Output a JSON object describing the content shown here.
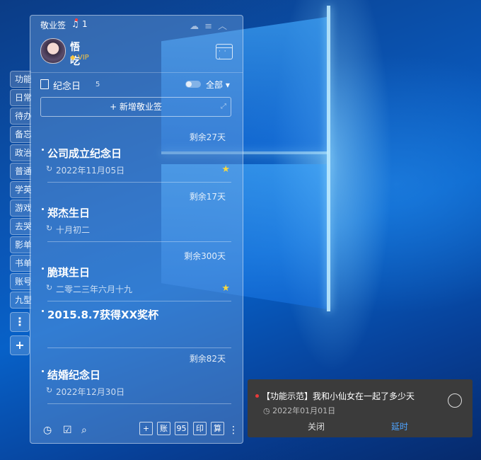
{
  "app": {
    "title": "敬业签",
    "notif_count": "1",
    "username": "悟吃",
    "vip": "VIP"
  },
  "category": {
    "name": "纪念日",
    "count": "5",
    "filter": "全部"
  },
  "add_button": "+ 新增敬业签",
  "side_tabs": [
    "功能",
    "日常",
    "待办",
    "备忘",
    "政治",
    "普通",
    "学英",
    "游戏",
    "去哭",
    "影单",
    "书单",
    "账号",
    "九型"
  ],
  "items": [
    {
      "remain": "剩余27天",
      "title": "公司成立纪念日",
      "date": "2022年11月05日",
      "starred": true
    },
    {
      "remain": "剩余17天",
      "title": "郑杰生日",
      "date": "十月初二",
      "starred": false
    },
    {
      "remain": "剩余300天",
      "title": "脆琪生日",
      "date": "二零二三年六月十九",
      "starred": true
    },
    {
      "remain": "",
      "title": "2015.8.7获得XX奖杯",
      "date": "",
      "starred": false
    },
    {
      "remain": "剩余82天",
      "title": "结婚纪念日",
      "date": "2022年12月30日",
      "starred": false
    }
  ],
  "bottom_buttons": [
    "+",
    "账",
    "95",
    "印",
    "算"
  ],
  "notification": {
    "text": "【功能示范】我和小仙女在一起了多少天",
    "date": "2022年01月01日",
    "close": "关闭",
    "delay": "延时"
  }
}
